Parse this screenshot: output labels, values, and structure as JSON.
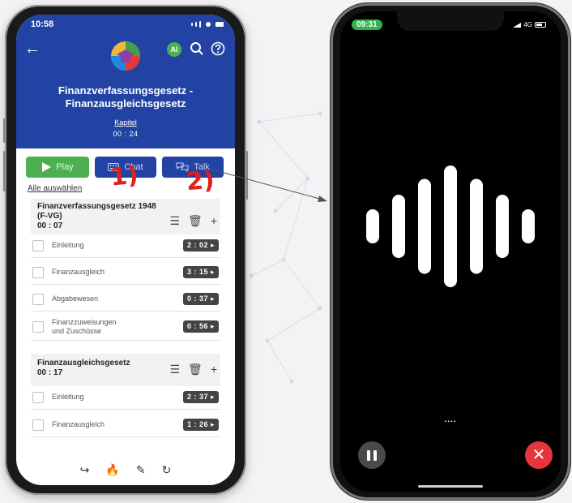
{
  "left_phone": {
    "status_time": "10:58",
    "ai_badge": "AI",
    "title_line1": "Finanzverfassungsgesetz -",
    "title_line2": "Finanzausgleichsgesetz",
    "kapitel": "Kapitel",
    "duration": "00 : 24",
    "buttons": {
      "play": "Play",
      "chat": "Chat",
      "talk": "Talk"
    },
    "select_all": "Alle auswählen",
    "sections": [
      {
        "title_line1": "Finanzverfassungsgesetz 1948",
        "title_line2": "(F-VG)",
        "time": "00 : 07",
        "items": [
          {
            "label": "Einleitung",
            "time": "2 : 02 ▸"
          },
          {
            "label": "Finanzausgleich",
            "time": "3 : 15 ▸"
          },
          {
            "label": "Abgabewesen",
            "time": "0 : 37 ▸"
          },
          {
            "label_line1": "Finanzzuweisungen",
            "label_line2": "und Zuschüsse",
            "time": "0 : 56 ▸"
          }
        ]
      },
      {
        "title_line1": "Finanzausgleichsgesetz",
        "time": "00 : 17",
        "items": [
          {
            "label": "Einleitung",
            "time": "2 : 37 ▸"
          },
          {
            "label": "Finanzausgleich",
            "time": "1 : 26 ▸"
          }
        ]
      }
    ],
    "icons": {
      "back": "back-arrow-icon",
      "search": "search-icon",
      "help": "help-icon",
      "list": "list-icon",
      "trash": "trash-icon",
      "add": "plus-icon",
      "share": "share-icon",
      "fire": "fire-icon",
      "edit": "edit-icon",
      "refresh": "refresh-icon"
    },
    "annotations": [
      "1)",
      "2)"
    ],
    "colors": {
      "header": "#2243a3",
      "play": "#4caf50",
      "annotation": "#e0201b"
    }
  },
  "right_phone": {
    "status_time": "09:31",
    "network": "4G",
    "indicator": "....",
    "wave_bar_levels": [
      0.28,
      0.52,
      0.78,
      1.0,
      0.78,
      0.52,
      0.28
    ],
    "colors": {
      "time_pill": "#2fb34a",
      "close": "#e8343b"
    }
  }
}
